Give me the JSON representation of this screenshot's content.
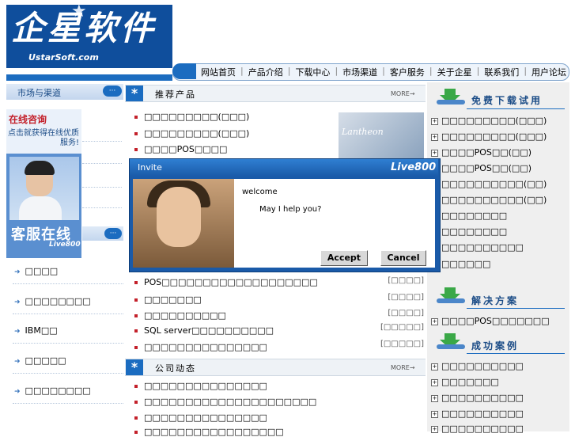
{
  "logo": {
    "main": "企星软件",
    "sub": "UstarSoft.com"
  },
  "nav": [
    "网站首页",
    "产品介绍",
    "下载中心",
    "市场渠道",
    "客户服务",
    "关于企星",
    "联系我们",
    "用户论坛"
  ],
  "left": {
    "section_title": "市场与渠道",
    "dots": "···",
    "cs_title": "在线咨询",
    "cs_desc": "点击就获得在线优质服务!",
    "cs_label": "客服在线",
    "cs_live": "Live800",
    "list": [
      "□□□□",
      "□□□□□□□□",
      "IBM□□",
      "□□□□□",
      "□□□□□□□□"
    ]
  },
  "products": {
    "title": "推荐产品",
    "more": "MORE→",
    "items": [
      "□□□□□□□□□(□□□)",
      "□□□□□□□□□(□□□)",
      "□□□□POS□□□□"
    ],
    "promo_text": "Lantheon"
  },
  "articles": [
    {
      "text": "POS□□□□□□□□□□□□□□□□□□□",
      "tag": "[□□□□]"
    },
    {
      "text": "□□□□□□□",
      "tag": "[□□□□]"
    },
    {
      "text": "□□□□□□□□□□",
      "tag": "[□□□□]"
    },
    {
      "text": "SQL server□□□□□□□□□□",
      "tag": "[□□□□□]"
    },
    {
      "text": "□□□□□□□□□□□□□□□",
      "tag": "[□□□□□]"
    }
  ],
  "news": {
    "title": "公司动态",
    "more": "MORE→",
    "items": [
      "□□□□□□□□□□□□□□□",
      "□□□□□□□□□□□□□□□□□□□□□",
      "□□□□□□□□□□□□□□□",
      "□□□□□□□□□□□□□□□□□"
    ]
  },
  "right": {
    "download_title": "免费下载试用",
    "download_items": [
      "□□□□□□□□□(□□□)",
      "□□□□□□□□□(□□□)",
      "□□□□POS□□(□□)",
      "□□□□POS□□(□□)",
      "□□□□□□□□□□(□□)",
      "□□□□□□□□□□(□□)",
      "□□□□□□□□",
      "□□□□□□□□",
      "□□□□□□□□□□",
      "□□□□□□"
    ],
    "solutions_title": "解决方案",
    "solutions_items": [
      "□□□□POS□□□□□□□"
    ],
    "cases_title": "成功案例",
    "cases_items": [
      "□□□□□□□□□□",
      "□□□□□□□",
      "□□□□□□□□□□",
      "□□□□□□□□□□",
      "□□□□□□□□□□"
    ]
  },
  "popup": {
    "title": "Invite",
    "brand": "Live800",
    "welcome": "welcome",
    "help": "May I help you?",
    "accept": "Accept",
    "cancel": "Cancel"
  },
  "colors": {
    "brand_blue": "#1b6cc0",
    "bullet_red": "#c3202a",
    "arrow_green": "#3aa847"
  }
}
